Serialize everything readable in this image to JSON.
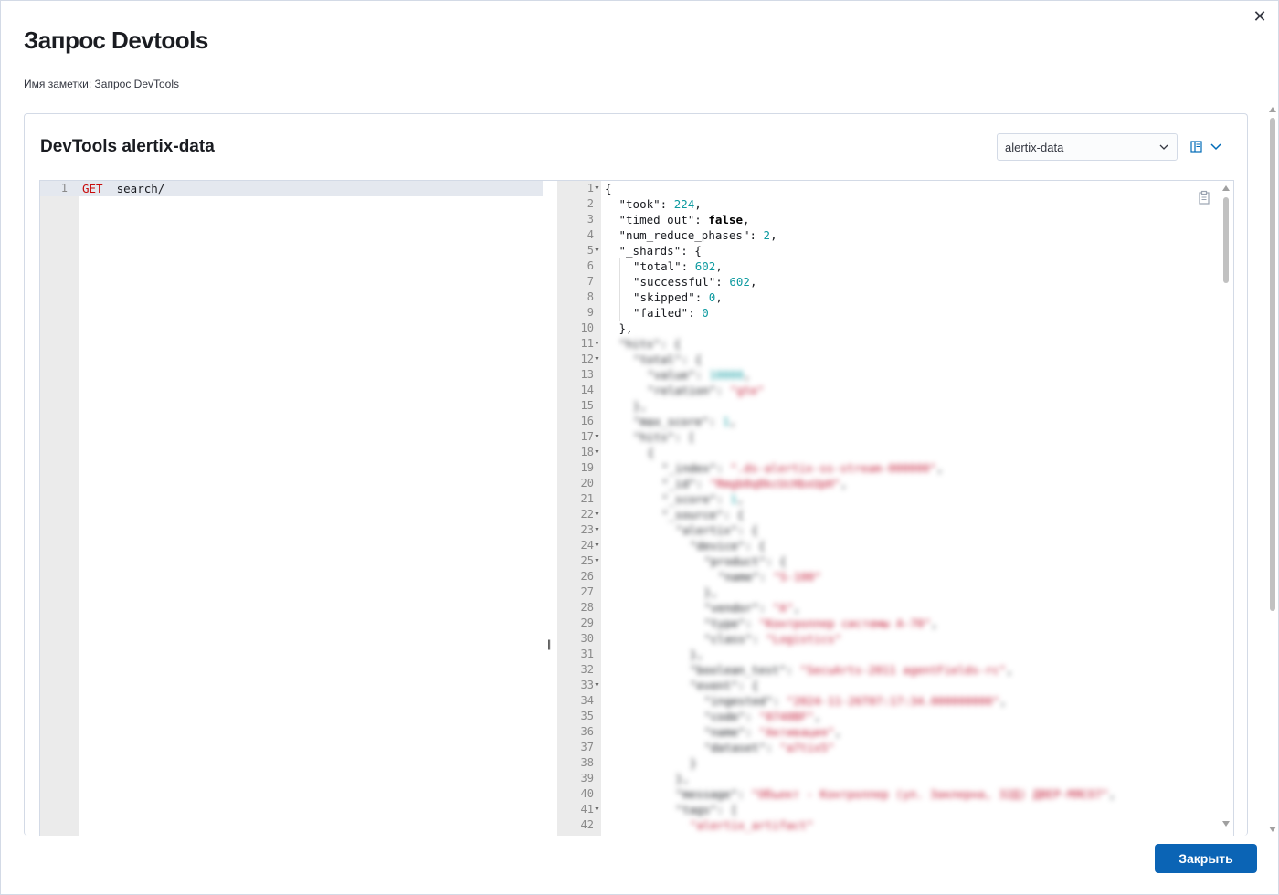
{
  "modal": {
    "title": "Запрос Devtools",
    "note_label": "Имя заметки:",
    "note_name": "Запрос DevTools",
    "close_button": "Закрыть"
  },
  "panel": {
    "title": "DevTools alertix-data",
    "index_select": "alertix-data"
  },
  "request": {
    "lines": [
      {
        "n": "1",
        "method": "GET",
        "path": "_search/"
      }
    ]
  },
  "response": {
    "lines": [
      {
        "n": "1",
        "fold": true,
        "indent": 0,
        "tokens": [
          [
            "p",
            "{"
          ]
        ]
      },
      {
        "n": "2",
        "indent": 1,
        "tokens": [
          [
            "p",
            "\"took\": "
          ],
          [
            "num",
            "224"
          ],
          [
            "p",
            ","
          ]
        ]
      },
      {
        "n": "3",
        "indent": 1,
        "tokens": [
          [
            "p",
            "\"timed_out\": "
          ],
          [
            "bool",
            "false"
          ],
          [
            "p",
            ","
          ]
        ]
      },
      {
        "n": "4",
        "indent": 1,
        "tokens": [
          [
            "p",
            "\"num_reduce_phases\": "
          ],
          [
            "num",
            "2"
          ],
          [
            "p",
            ","
          ]
        ]
      },
      {
        "n": "5",
        "fold": true,
        "indent": 1,
        "tokens": [
          [
            "p",
            "\"_shards\": {"
          ]
        ]
      },
      {
        "n": "6",
        "indent": 2,
        "tokens": [
          [
            "p",
            "\"total\": "
          ],
          [
            "num",
            "602"
          ],
          [
            "p",
            ","
          ]
        ]
      },
      {
        "n": "7",
        "indent": 2,
        "tokens": [
          [
            "p",
            "\"successful\": "
          ],
          [
            "num",
            "602"
          ],
          [
            "p",
            ","
          ]
        ]
      },
      {
        "n": "8",
        "indent": 2,
        "tokens": [
          [
            "p",
            "\"skipped\": "
          ],
          [
            "num",
            "0"
          ],
          [
            "p",
            ","
          ]
        ]
      },
      {
        "n": "9",
        "indent": 2,
        "tokens": [
          [
            "p",
            "\"failed\": "
          ],
          [
            "num",
            "0"
          ]
        ]
      },
      {
        "n": "10",
        "indent": 1,
        "tokens": [
          [
            "p",
            "},"
          ]
        ]
      },
      {
        "n": "11",
        "fold": true,
        "blur": true,
        "indent": 1,
        "tokens": [
          [
            "p",
            "\"hits\": {"
          ]
        ]
      },
      {
        "n": "12",
        "fold": true,
        "blur": true,
        "indent": 2,
        "tokens": [
          [
            "p",
            "\"total\": {"
          ]
        ]
      },
      {
        "n": "13",
        "blur": true,
        "indent": 3,
        "tokens": [
          [
            "p",
            "\"value\": "
          ],
          [
            "num",
            "10000"
          ],
          [
            "p",
            ","
          ]
        ]
      },
      {
        "n": "14",
        "blur": true,
        "indent": 3,
        "tokens": [
          [
            "p",
            "\"relation\": "
          ],
          [
            "str",
            "\"gte\""
          ]
        ]
      },
      {
        "n": "15",
        "blur": true,
        "indent": 2,
        "tokens": [
          [
            "p",
            "},"
          ]
        ]
      },
      {
        "n": "16",
        "blur": true,
        "indent": 2,
        "tokens": [
          [
            "p",
            "\"max_score\": "
          ],
          [
            "num",
            "1"
          ],
          [
            "p",
            ","
          ]
        ]
      },
      {
        "n": "17",
        "fold": true,
        "blur": true,
        "indent": 2,
        "tokens": [
          [
            "p",
            "\"hits\": ["
          ]
        ]
      },
      {
        "n": "18",
        "fold": true,
        "blur": true,
        "indent": 3,
        "tokens": [
          [
            "p",
            "{"
          ]
        ]
      },
      {
        "n": "19",
        "blur": true,
        "indent": 4,
        "tokens": [
          [
            "p",
            "\"_index\": "
          ],
          [
            "str",
            "\".ds-alertix-ss-stream-000000\""
          ],
          [
            "p",
            ","
          ]
        ]
      },
      {
        "n": "20",
        "blur": true,
        "indent": 4,
        "tokens": [
          [
            "p",
            "\"_id\": "
          ],
          [
            "str",
            "\"Rmgb0q8kcUcHbxUpH\""
          ],
          [
            "p",
            ","
          ]
        ]
      },
      {
        "n": "21",
        "blur": true,
        "indent": 4,
        "tokens": [
          [
            "p",
            "\"_score\": "
          ],
          [
            "num",
            "1"
          ],
          [
            "p",
            ","
          ]
        ]
      },
      {
        "n": "22",
        "fold": true,
        "blur": true,
        "indent": 4,
        "tokens": [
          [
            "p",
            "\"_source\": {"
          ]
        ]
      },
      {
        "n": "23",
        "fold": true,
        "blur": true,
        "indent": 5,
        "tokens": [
          [
            "p",
            "\"alertix\": {"
          ]
        ]
      },
      {
        "n": "24",
        "fold": true,
        "blur": true,
        "indent": 6,
        "tokens": [
          [
            "p",
            "\"device\": {"
          ]
        ]
      },
      {
        "n": "25",
        "fold": true,
        "blur": true,
        "indent": 7,
        "tokens": [
          [
            "p",
            "\"product\": {"
          ]
        ]
      },
      {
        "n": "26",
        "blur": true,
        "indent": 8,
        "tokens": [
          [
            "p",
            "\"name\": "
          ],
          [
            "str",
            "\"S-100\""
          ]
        ]
      },
      {
        "n": "27",
        "blur": true,
        "indent": 7,
        "tokens": [
          [
            "p",
            "},"
          ]
        ]
      },
      {
        "n": "28",
        "blur": true,
        "indent": 7,
        "tokens": [
          [
            "p",
            "\"vendor\": "
          ],
          [
            "str",
            "\"A\""
          ],
          [
            "p",
            ","
          ]
        ]
      },
      {
        "n": "29",
        "blur": true,
        "indent": 7,
        "tokens": [
          [
            "p",
            "\"type\": "
          ],
          [
            "str",
            "\"Контроллер системы A-70\""
          ],
          [
            "p",
            ","
          ]
        ]
      },
      {
        "n": "30",
        "blur": true,
        "indent": 7,
        "tokens": [
          [
            "p",
            "\"class\": "
          ],
          [
            "str",
            "\"Logistics\""
          ]
        ]
      },
      {
        "n": "31",
        "blur": true,
        "indent": 6,
        "tokens": [
          [
            "p",
            "},"
          ]
        ]
      },
      {
        "n": "32",
        "blur": true,
        "indent": 6,
        "tokens": [
          [
            "p",
            "\"boolean_test\": "
          ],
          [
            "str",
            "\"SecuArts-2011 agentFields-rc\""
          ],
          [
            "p",
            ","
          ]
        ]
      },
      {
        "n": "33",
        "fold": true,
        "blur": true,
        "indent": 6,
        "tokens": [
          [
            "p",
            "\"event\": {"
          ]
        ]
      },
      {
        "n": "34",
        "blur": true,
        "indent": 7,
        "tokens": [
          [
            "p",
            "\"ingested\": "
          ],
          [
            "str",
            "\"2024-11-26T07:17:34.000000000\""
          ],
          [
            "p",
            ","
          ]
        ]
      },
      {
        "n": "35",
        "blur": true,
        "indent": 7,
        "tokens": [
          [
            "p",
            "\"code\": "
          ],
          [
            "str",
            "\"0740BF\""
          ],
          [
            "p",
            ","
          ]
        ]
      },
      {
        "n": "36",
        "blur": true,
        "indent": 7,
        "tokens": [
          [
            "p",
            "\"name\": "
          ],
          [
            "str",
            "\"Активация\""
          ],
          [
            "p",
            ","
          ]
        ]
      },
      {
        "n": "37",
        "blur": true,
        "indent": 7,
        "tokens": [
          [
            "p",
            "\"dataset\": "
          ],
          [
            "str",
            "\"a7tix5\""
          ]
        ]
      },
      {
        "n": "38",
        "blur": true,
        "indent": 6,
        "tokens": [
          [
            "p",
            "}"
          ]
        ]
      },
      {
        "n": "39",
        "blur": true,
        "indent": 5,
        "tokens": [
          [
            "p",
            "},"
          ]
        ]
      },
      {
        "n": "40",
        "blur": true,
        "indent": 5,
        "tokens": [
          [
            "p",
            "\"message\": "
          ],
          [
            "str",
            "\"Объект - Контроллер (ул. Заклерна, 32Д) ДВЕР-МЯСО7\""
          ],
          [
            "p",
            ","
          ]
        ]
      },
      {
        "n": "41",
        "fold": true,
        "blur": true,
        "indent": 5,
        "tokens": [
          [
            "p",
            "\"tags\": ["
          ]
        ]
      },
      {
        "n": "42",
        "blur": true,
        "indent": 6,
        "tokens": [
          [
            "str",
            "\"alertix_artifact\""
          ]
        ]
      }
    ]
  },
  "icons": {
    "close": "close-icon",
    "select_chevron": "chevron-down-icon",
    "view": "panel-layout-icon",
    "view_chevron": "chevron-down-icon",
    "copy": "clipboard-icon"
  },
  "colors": {
    "primary_button": "#0b64b5",
    "number_token": "#0d9aa0",
    "string_token": "#c41e3a",
    "get_keyword": "#c80a0a"
  }
}
